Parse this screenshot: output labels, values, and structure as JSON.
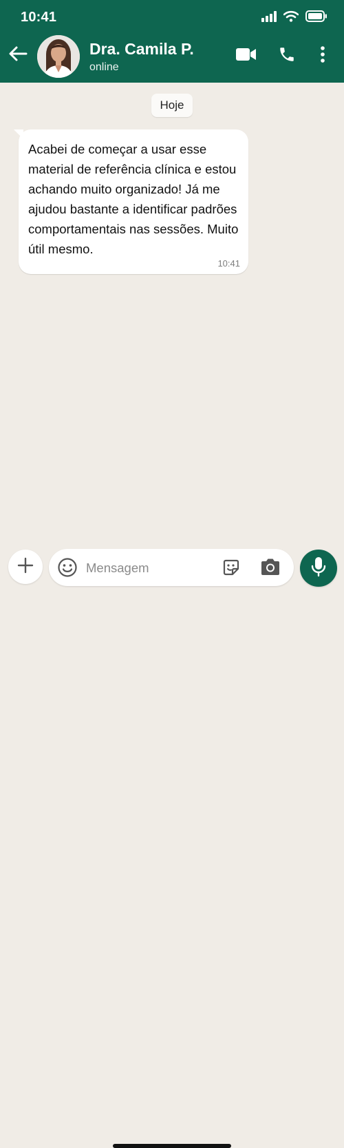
{
  "status_bar": {
    "time": "10:41"
  },
  "header": {
    "contact_name": "Dra. Camila P.",
    "contact_status": "online",
    "icons": [
      "back-arrow-icon",
      "avatar",
      "video-call-icon",
      "phone-icon",
      "more-vert-icon"
    ]
  },
  "chat": {
    "date_chip": "Hoje",
    "messages": [
      {
        "text": "Acabei de começar a usar esse material de referência clínica e estou achando muito organizado! Já me ajudou bastante a identificar padrões comportamentais nas sessões. Muito útil mesmo.",
        "time": "10:41",
        "direction": "incoming"
      }
    ]
  },
  "composer": {
    "placeholder": "Mensagem",
    "icons": [
      "plus-icon",
      "emoji-icon",
      "sticker-icon",
      "camera-icon",
      "mic-icon"
    ]
  },
  "colors": {
    "header_green": "#0e6650",
    "chat_bg": "#f0ece6",
    "bubble_bg": "#ffffff"
  }
}
